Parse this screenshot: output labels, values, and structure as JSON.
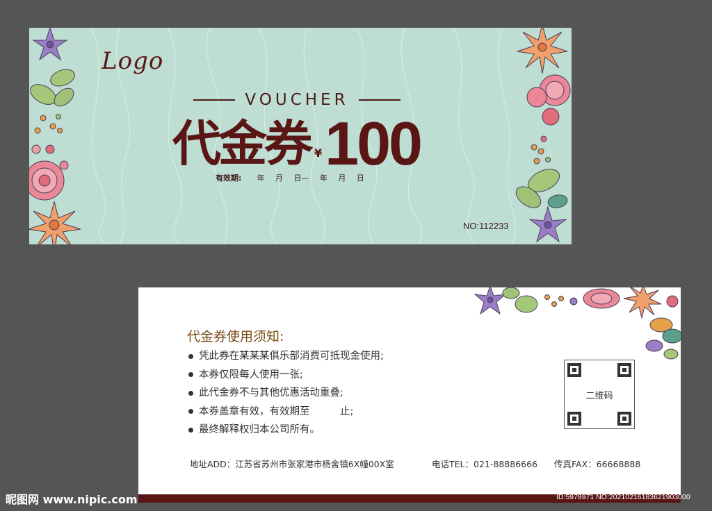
{
  "front": {
    "logo": "Logo",
    "voucher_word": "VOUCHER",
    "title": "代金券",
    "currency": "¥",
    "amount": "100",
    "validity_label": "有效期:",
    "validity_dates": "年 月 日— 年 月 日",
    "serial": "NO:112233",
    "background_color": "#bfded3",
    "text_color": "#5a1614"
  },
  "back": {
    "rules_title": "代金券使用须知:",
    "rules": [
      "凭此券在某某某俱乐部消费可抵现金使用;",
      "本券仅限每人使用一张;",
      "此代金券不与其他优惠活动重叠;",
      "本券盖章有效，有效期至　　　止;",
      "最终解释权归本公司所有。"
    ],
    "qr_label": "二维码",
    "address": "地址ADD：江苏省苏州市张家港市杨舍镇6X幢00X室",
    "phone": "电话TEL：021-88886666",
    "fax": "传真FAX：66668888",
    "bar_color": "#5a1614"
  },
  "watermark": {
    "left": "昵图网 www.nipic.com",
    "right": "ID:5978971 NO:20210216183621903000"
  }
}
